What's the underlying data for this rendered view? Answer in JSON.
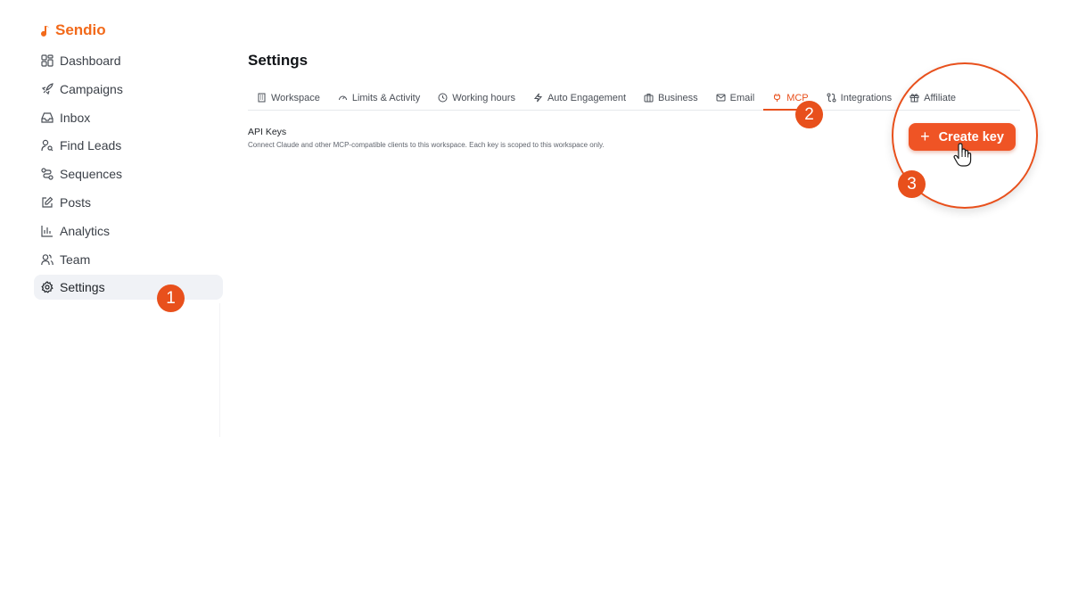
{
  "brand": {
    "name": "Sendio",
    "accent": "#f26a1b"
  },
  "sidebar": {
    "items": [
      {
        "label": "Dashboard",
        "icon": "dashboard-icon"
      },
      {
        "label": "Campaigns",
        "icon": "rocket-icon"
      },
      {
        "label": "Inbox",
        "icon": "inbox-icon"
      },
      {
        "label": "Find Leads",
        "icon": "user-search-icon"
      },
      {
        "label": "Sequences",
        "icon": "route-icon"
      },
      {
        "label": "Posts",
        "icon": "edit-icon"
      },
      {
        "label": "Analytics",
        "icon": "bar-chart-icon"
      },
      {
        "label": "Team",
        "icon": "users-icon"
      },
      {
        "label": "Settings",
        "icon": "gear-icon",
        "active": true
      }
    ]
  },
  "main": {
    "title": "Settings",
    "tabs": [
      {
        "label": "Workspace",
        "icon": "building-icon"
      },
      {
        "label": "Limits & Activity",
        "icon": "gauge-icon"
      },
      {
        "label": "Working hours",
        "icon": "clock-icon"
      },
      {
        "label": "Auto Engagement",
        "icon": "zap-icon"
      },
      {
        "label": "Business",
        "icon": "briefcase-icon"
      },
      {
        "label": "Email",
        "icon": "mail-icon"
      },
      {
        "label": "MCP",
        "icon": "plug-icon",
        "active": true
      },
      {
        "label": "Integrations",
        "icon": "integrations-icon"
      },
      {
        "label": "Affiliate",
        "icon": "gift-icon"
      }
    ],
    "section": {
      "title": "API Keys",
      "description": "Connect Claude and other MCP-compatible clients to this workspace. Each key is scoped to this workspace only."
    },
    "create_button": {
      "label": "Create key",
      "plus": "+"
    }
  },
  "steps": [
    "1",
    "2",
    "3"
  ],
  "colors": {
    "accent": "#e8501c",
    "button": "#ef5425",
    "active_nav_bg": "#f0f2f6"
  }
}
